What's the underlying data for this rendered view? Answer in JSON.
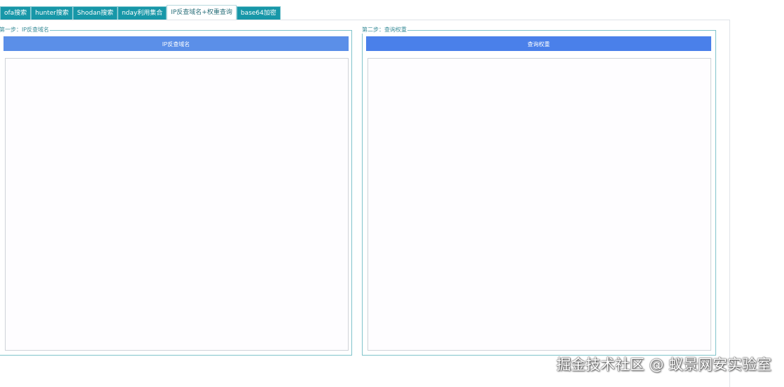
{
  "tabs": [
    {
      "label": "ofa搜索",
      "active": false
    },
    {
      "label": "hunter搜索",
      "active": false
    },
    {
      "label": "Shodan搜索",
      "active": false
    },
    {
      "label": "nday利用集合",
      "active": false
    },
    {
      "label": "IP反查域名+权重查询",
      "active": true
    },
    {
      "label": "base64加密",
      "active": false
    }
  ],
  "step1": {
    "legend": "第一步：IP反查域名",
    "button_label": "IP反查域名",
    "output_value": ""
  },
  "step2": {
    "legend": "第二步：查询权重",
    "button_label": "查询权重",
    "output_value": ""
  },
  "watermark": "掘金技术社区 @ 蚁景网安实验室",
  "colors": {
    "tab_bg": "#1797a8",
    "group_border": "#7fc3ca",
    "button_left": "#5b8fe8",
    "button_right": "#4a80ea"
  }
}
